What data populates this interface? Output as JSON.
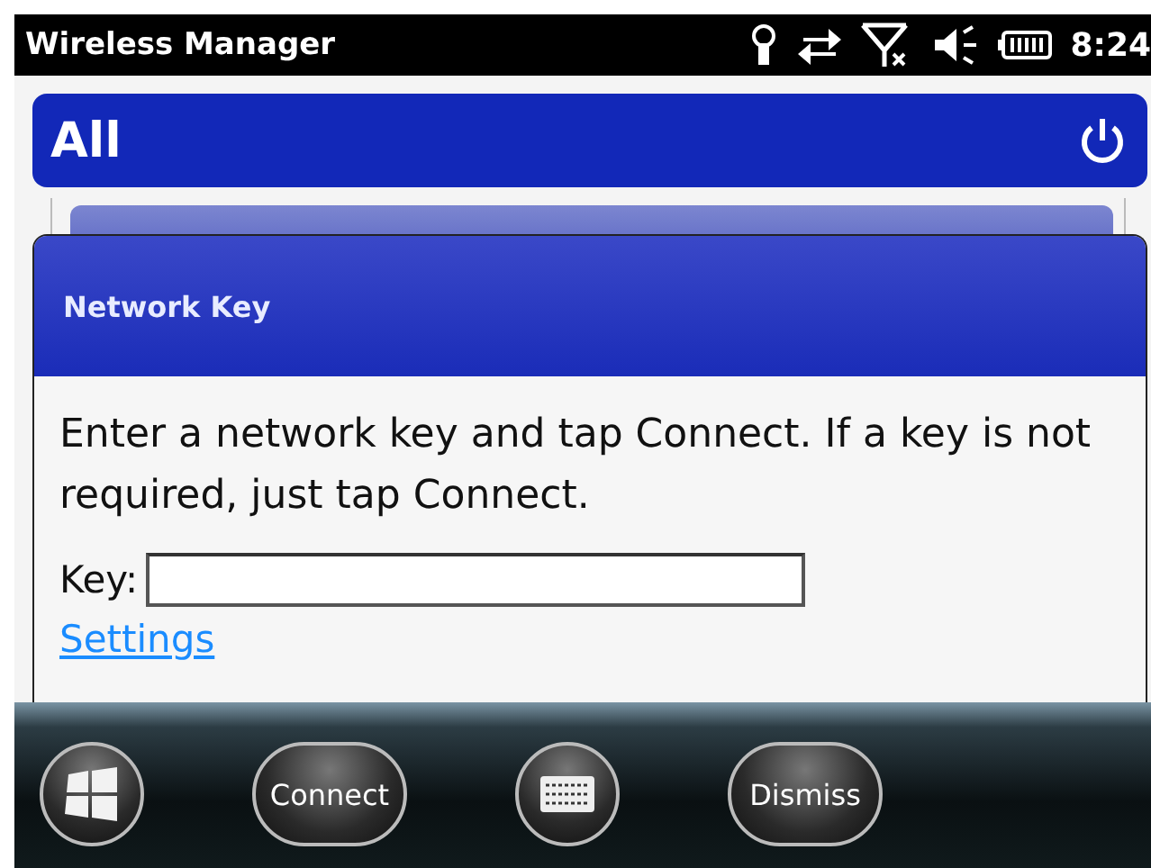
{
  "status_bar": {
    "title": "Wireless Manager",
    "time": "8:24"
  },
  "header": {
    "title": "All"
  },
  "dialog": {
    "title": "Network Key",
    "message": "Enter a network key and tap Connect. If a key is not required, just tap Connect.",
    "key_label": "Key:",
    "link": "Settings"
  },
  "softkeys": [
    {
      "kind": "start"
    },
    {
      "kind": "text",
      "label": "Connect"
    },
    {
      "kind": "keyboard"
    },
    {
      "kind": "text",
      "label": "Dismiss"
    }
  ]
}
